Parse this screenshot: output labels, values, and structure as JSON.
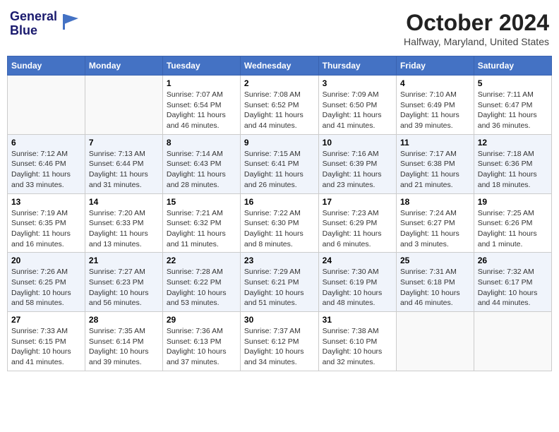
{
  "header": {
    "logo_line1": "General",
    "logo_line2": "Blue",
    "month": "October 2024",
    "location": "Halfway, Maryland, United States"
  },
  "days_of_week": [
    "Sunday",
    "Monday",
    "Tuesday",
    "Wednesday",
    "Thursday",
    "Friday",
    "Saturday"
  ],
  "weeks": [
    [
      {
        "day": "",
        "info": ""
      },
      {
        "day": "",
        "info": ""
      },
      {
        "day": "1",
        "info": "Sunrise: 7:07 AM\nSunset: 6:54 PM\nDaylight: 11 hours and 46 minutes."
      },
      {
        "day": "2",
        "info": "Sunrise: 7:08 AM\nSunset: 6:52 PM\nDaylight: 11 hours and 44 minutes."
      },
      {
        "day": "3",
        "info": "Sunrise: 7:09 AM\nSunset: 6:50 PM\nDaylight: 11 hours and 41 minutes."
      },
      {
        "day": "4",
        "info": "Sunrise: 7:10 AM\nSunset: 6:49 PM\nDaylight: 11 hours and 39 minutes."
      },
      {
        "day": "5",
        "info": "Sunrise: 7:11 AM\nSunset: 6:47 PM\nDaylight: 11 hours and 36 minutes."
      }
    ],
    [
      {
        "day": "6",
        "info": "Sunrise: 7:12 AM\nSunset: 6:46 PM\nDaylight: 11 hours and 33 minutes."
      },
      {
        "day": "7",
        "info": "Sunrise: 7:13 AM\nSunset: 6:44 PM\nDaylight: 11 hours and 31 minutes."
      },
      {
        "day": "8",
        "info": "Sunrise: 7:14 AM\nSunset: 6:43 PM\nDaylight: 11 hours and 28 minutes."
      },
      {
        "day": "9",
        "info": "Sunrise: 7:15 AM\nSunset: 6:41 PM\nDaylight: 11 hours and 26 minutes."
      },
      {
        "day": "10",
        "info": "Sunrise: 7:16 AM\nSunset: 6:39 PM\nDaylight: 11 hours and 23 minutes."
      },
      {
        "day": "11",
        "info": "Sunrise: 7:17 AM\nSunset: 6:38 PM\nDaylight: 11 hours and 21 minutes."
      },
      {
        "day": "12",
        "info": "Sunrise: 7:18 AM\nSunset: 6:36 PM\nDaylight: 11 hours and 18 minutes."
      }
    ],
    [
      {
        "day": "13",
        "info": "Sunrise: 7:19 AM\nSunset: 6:35 PM\nDaylight: 11 hours and 16 minutes."
      },
      {
        "day": "14",
        "info": "Sunrise: 7:20 AM\nSunset: 6:33 PM\nDaylight: 11 hours and 13 minutes."
      },
      {
        "day": "15",
        "info": "Sunrise: 7:21 AM\nSunset: 6:32 PM\nDaylight: 11 hours and 11 minutes."
      },
      {
        "day": "16",
        "info": "Sunrise: 7:22 AM\nSunset: 6:30 PM\nDaylight: 11 hours and 8 minutes."
      },
      {
        "day": "17",
        "info": "Sunrise: 7:23 AM\nSunset: 6:29 PM\nDaylight: 11 hours and 6 minutes."
      },
      {
        "day": "18",
        "info": "Sunrise: 7:24 AM\nSunset: 6:27 PM\nDaylight: 11 hours and 3 minutes."
      },
      {
        "day": "19",
        "info": "Sunrise: 7:25 AM\nSunset: 6:26 PM\nDaylight: 11 hours and 1 minute."
      }
    ],
    [
      {
        "day": "20",
        "info": "Sunrise: 7:26 AM\nSunset: 6:25 PM\nDaylight: 10 hours and 58 minutes."
      },
      {
        "day": "21",
        "info": "Sunrise: 7:27 AM\nSunset: 6:23 PM\nDaylight: 10 hours and 56 minutes."
      },
      {
        "day": "22",
        "info": "Sunrise: 7:28 AM\nSunset: 6:22 PM\nDaylight: 10 hours and 53 minutes."
      },
      {
        "day": "23",
        "info": "Sunrise: 7:29 AM\nSunset: 6:21 PM\nDaylight: 10 hours and 51 minutes."
      },
      {
        "day": "24",
        "info": "Sunrise: 7:30 AM\nSunset: 6:19 PM\nDaylight: 10 hours and 48 minutes."
      },
      {
        "day": "25",
        "info": "Sunrise: 7:31 AM\nSunset: 6:18 PM\nDaylight: 10 hours and 46 minutes."
      },
      {
        "day": "26",
        "info": "Sunrise: 7:32 AM\nSunset: 6:17 PM\nDaylight: 10 hours and 44 minutes."
      }
    ],
    [
      {
        "day": "27",
        "info": "Sunrise: 7:33 AM\nSunset: 6:15 PM\nDaylight: 10 hours and 41 minutes."
      },
      {
        "day": "28",
        "info": "Sunrise: 7:35 AM\nSunset: 6:14 PM\nDaylight: 10 hours and 39 minutes."
      },
      {
        "day": "29",
        "info": "Sunrise: 7:36 AM\nSunset: 6:13 PM\nDaylight: 10 hours and 37 minutes."
      },
      {
        "day": "30",
        "info": "Sunrise: 7:37 AM\nSunset: 6:12 PM\nDaylight: 10 hours and 34 minutes."
      },
      {
        "day": "31",
        "info": "Sunrise: 7:38 AM\nSunset: 6:10 PM\nDaylight: 10 hours and 32 minutes."
      },
      {
        "day": "",
        "info": ""
      },
      {
        "day": "",
        "info": ""
      }
    ]
  ]
}
